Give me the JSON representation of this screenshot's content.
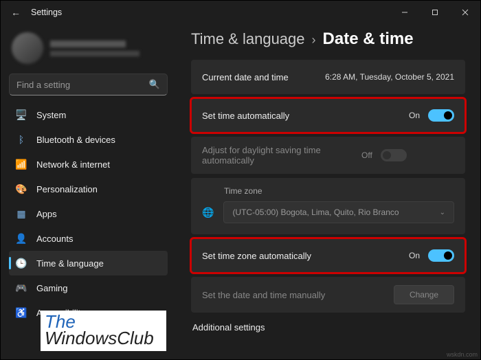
{
  "window": {
    "title": "Settings"
  },
  "search": {
    "placeholder": "Find a setting"
  },
  "nav": {
    "items": [
      {
        "label": "System",
        "icon": "🖥️",
        "active": false
      },
      {
        "label": "Bluetooth & devices",
        "icon": "ᛒ",
        "active": false
      },
      {
        "label": "Network & internet",
        "icon": "📶",
        "active": false
      },
      {
        "label": "Personalization",
        "icon": "🎨",
        "active": false
      },
      {
        "label": "Apps",
        "icon": "▦",
        "active": false
      },
      {
        "label": "Accounts",
        "icon": "👤",
        "active": false
      },
      {
        "label": "Time & language",
        "icon": "🕒",
        "active": true
      },
      {
        "label": "Gaming",
        "icon": "🎮",
        "active": false
      },
      {
        "label": "Accessibility",
        "icon": "♿",
        "active": false
      }
    ]
  },
  "breadcrumb": {
    "parent": "Time & language",
    "sep": "›",
    "current": "Date & time"
  },
  "rows": {
    "current": {
      "label": "Current date and time",
      "value": "6:28 AM, Tuesday, October 5, 2021"
    },
    "setTime": {
      "label": "Set time automatically",
      "state": "On"
    },
    "dst": {
      "label": "Adjust for daylight saving time automatically",
      "state": "Off"
    },
    "timezone": {
      "label": "Time zone",
      "value": "(UTC-05:00) Bogota, Lima, Quito, Rio Branco"
    },
    "setZone": {
      "label": "Set time zone automatically",
      "state": "On"
    },
    "manual": {
      "label": "Set the date and time manually",
      "button": "Change"
    }
  },
  "additional": {
    "title": "Additional settings"
  },
  "watermark": {
    "line1": "The",
    "line2": "WindowsClub"
  },
  "source": "wskdn.com"
}
